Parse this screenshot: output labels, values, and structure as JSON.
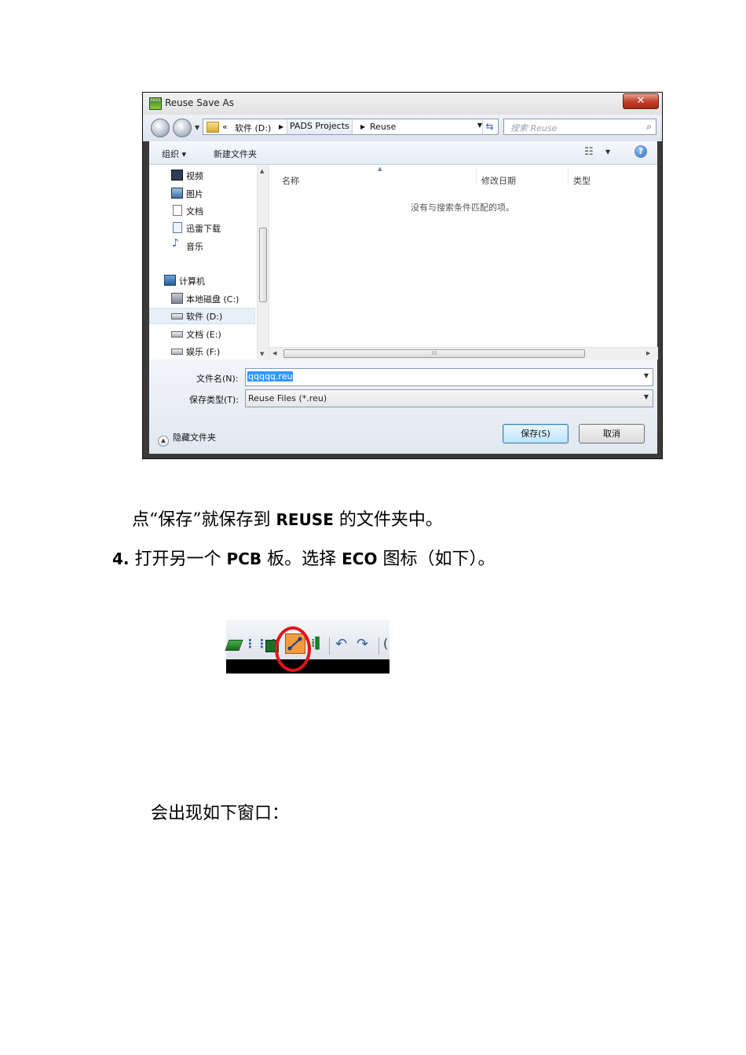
{
  "dialog": {
    "title": "Reuse Save As",
    "app_icon_text": "PADS",
    "close_label": "✕",
    "address": {
      "prefix": "«",
      "crumbs": [
        "软件 (D:)",
        "PADS Projects",
        "Reuse"
      ]
    },
    "search_placeholder": "搜索 Reuse",
    "toolbar": {
      "organize": "组织 ▾",
      "new_folder": "新建文件夹"
    },
    "nav": {
      "favorites": [
        "视频",
        "图片",
        "文档",
        "迅雷下载",
        "音乐"
      ],
      "computer": "计算机",
      "drives": [
        "本地磁盘 (C:)",
        "软件 (D:)",
        "文档 (E:)",
        "娱乐 (F:)"
      ]
    },
    "columns": [
      "名称",
      "修改日期",
      "类型"
    ],
    "empty_message": "没有与搜索条件匹配的项。",
    "filename_label": "文件名(N):",
    "filename_value": "qqqqq.reu",
    "filetype_label": "保存类型(T):",
    "filetype_value": "Reuse Files (*.reu)",
    "hide_folders": "隐藏文件夹",
    "save_button": "保存(S)",
    "cancel_button": "取消"
  },
  "text": {
    "line1_a": "点“保存”就保存到",
    "line1_b": "REUSE",
    "line1_c": "的文件夹中。",
    "line2_num": "4.",
    "line2_a": "打开另一个",
    "line2_b": "PCB",
    "line2_c": "板。选择",
    "line2_d": "ECO",
    "line2_e": "图标（如下）。",
    "line3": "会出现如下窗口："
  },
  "icons": {
    "toolbar_strip": [
      "layer-icon",
      "net-icon",
      "board-icon",
      "eco-icon",
      "component-icon",
      "undo-icon",
      "redo-icon"
    ],
    "highlight_color": "#e0151a",
    "eco_color": "#f39a3c"
  }
}
